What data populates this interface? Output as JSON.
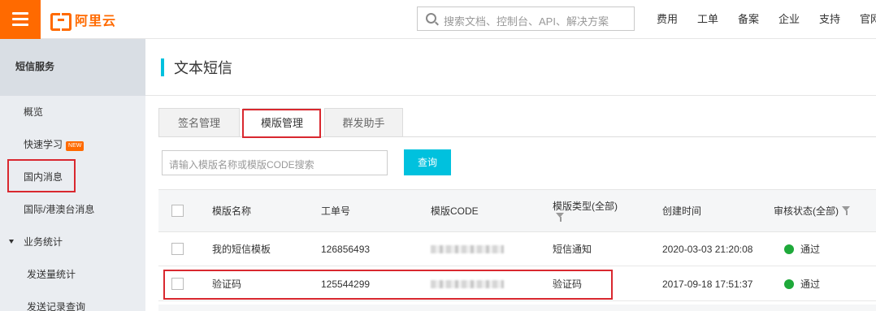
{
  "header": {
    "brand": "阿里云",
    "search_placeholder": "搜索文档、控制台、API、解决方案",
    "nav": [
      "费用",
      "工单",
      "备案",
      "企业",
      "支持",
      "官网"
    ]
  },
  "sidebar": {
    "title": "短信服务",
    "items": [
      {
        "label": "概览"
      },
      {
        "label": "快速学习",
        "badge": "NEW"
      },
      {
        "label": "国内消息"
      },
      {
        "label": "国际/港澳台消息"
      },
      {
        "label": "业务统计"
      },
      {
        "label": "发送量统计"
      },
      {
        "label": "发送记录查询"
      }
    ]
  },
  "page": {
    "title": "文本短信",
    "tabs": [
      "签名管理",
      "模版管理",
      "群发助手"
    ],
    "active_tab": "模版管理",
    "query_placeholder": "请输入模版名称或模版CODE搜索",
    "query_button": "查询"
  },
  "table": {
    "columns": {
      "name": "模版名称",
      "ticket": "工单号",
      "code": "模版CODE",
      "type": "模版类型(全部)",
      "created": "创建时间",
      "status": "审核状态(全部)"
    },
    "rows": [
      {
        "name": "我的短信模板",
        "ticket": "126856493",
        "type": "短信通知",
        "created": "2020-03-03 21:20:08",
        "status": "通过"
      },
      {
        "name": "验证码",
        "ticket": "125544299",
        "type": "验证码",
        "created": "2017-09-18 17:51:37",
        "status": "通过"
      }
    ]
  },
  "colors": {
    "brand_orange": "#ff6a00",
    "accent_cyan": "#00c1de",
    "highlight_red": "#d9282f",
    "status_green": "#1ea93a"
  }
}
